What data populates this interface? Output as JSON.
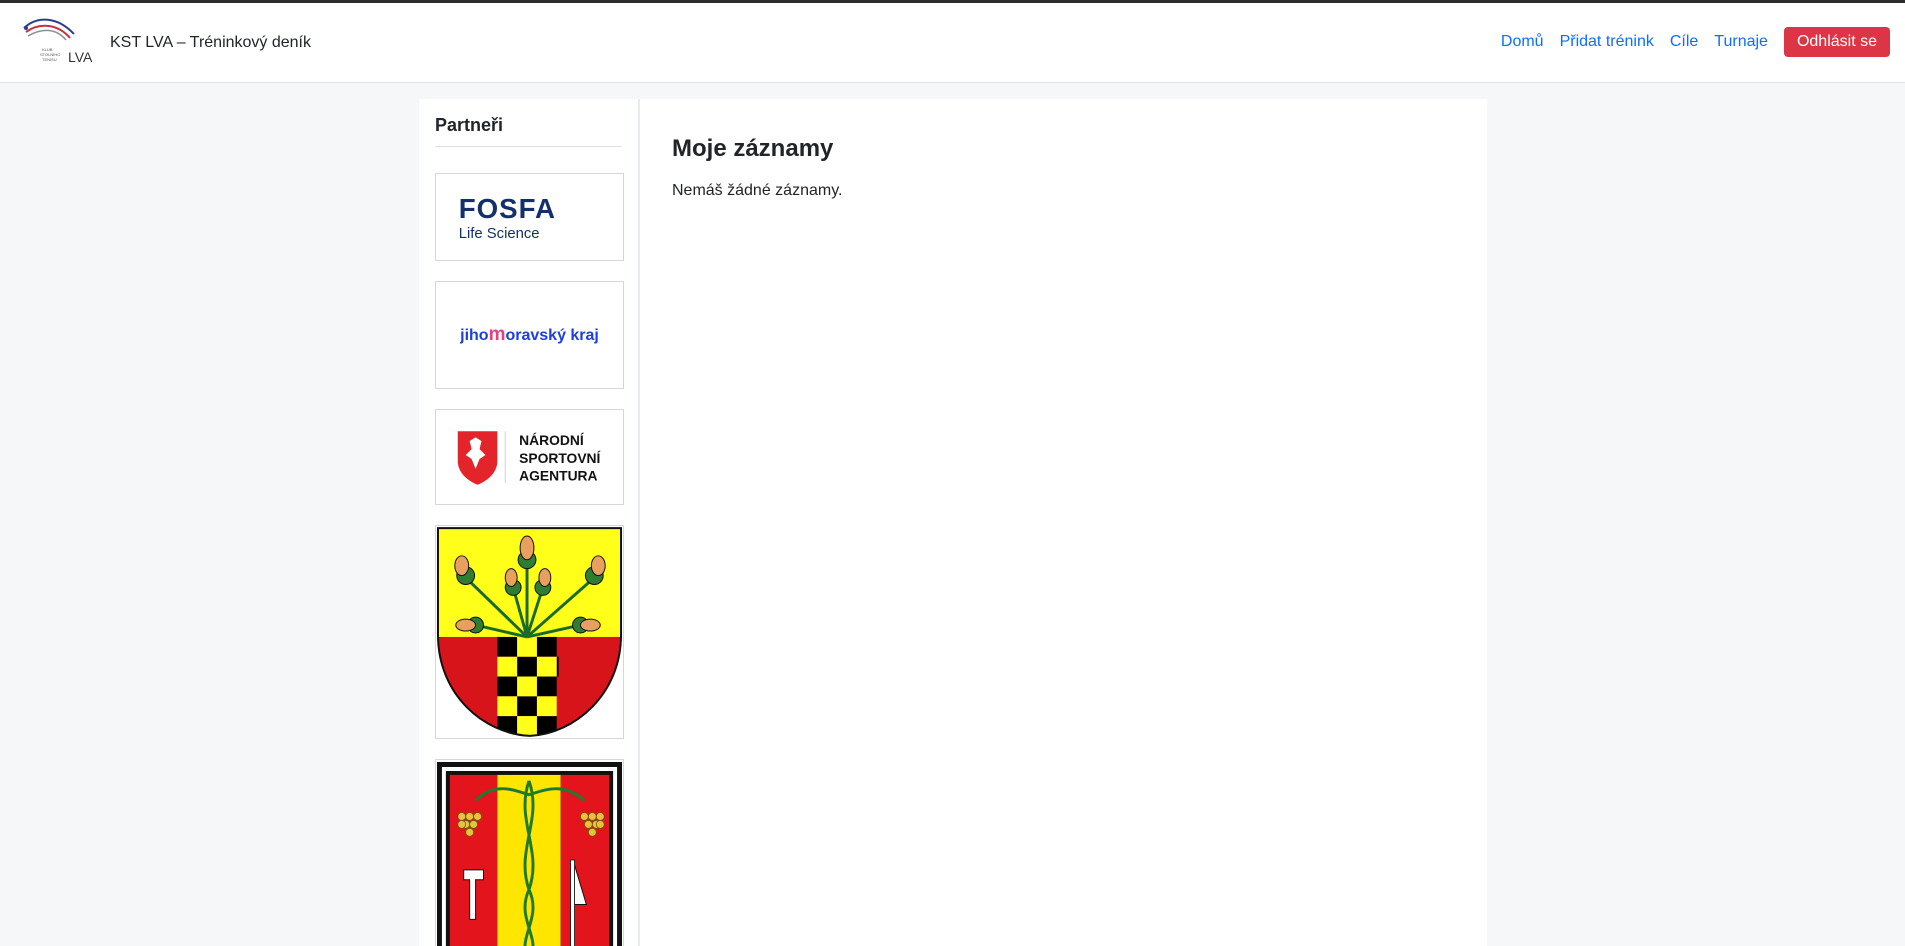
{
  "header": {
    "title": "KST LVA – Tréninkový deník",
    "logo_text": "LVA",
    "logo_small": [
      "KLUB",
      "STOLNÍHO",
      "TENISU"
    ]
  },
  "nav": {
    "home": "Domů",
    "add_training": "Přidat trénink",
    "goals": "Cíle",
    "tournaments": "Turnaje",
    "logout": "Odhlásit se"
  },
  "sidebar": {
    "title": "Partneři",
    "partners": [
      {
        "name": "FOSFA",
        "subtitle": "Life Science"
      },
      {
        "name": "jihomoravský kraj"
      },
      {
        "name": "NÁRODNÍ SPORTOVNÍ AGENTURA",
        "lines": [
          "NÁRODNÍ",
          "SPORTOVNÍ",
          "AGENTURA"
        ]
      },
      {
        "name": "municipal-coat-of-arms-1"
      },
      {
        "name": "municipal-coat-of-arms-2"
      }
    ]
  },
  "main": {
    "title": "Moje záznamy",
    "empty_message": "Nemáš žádné záznamy."
  },
  "colors": {
    "link": "#0d6efd",
    "danger": "#dc3545",
    "fosfa_blue": "#13306b",
    "jmk_blue": "#1d3fe0",
    "jmk_pink": "#e8417a"
  }
}
